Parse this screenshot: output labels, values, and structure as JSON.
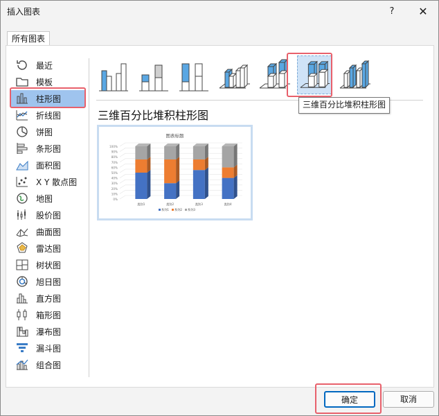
{
  "window": {
    "title": "插入图表",
    "help_icon": "?",
    "close_icon": "✕"
  },
  "tabs": [
    "所有图表"
  ],
  "sidebar": {
    "selected_index": 2,
    "items": [
      {
        "label": "最近",
        "icon": "recent-icon"
      },
      {
        "label": "模板",
        "icon": "folder-icon"
      },
      {
        "label": "柱形图",
        "icon": "column-chart-icon"
      },
      {
        "label": "折线图",
        "icon": "line-chart-icon"
      },
      {
        "label": "饼图",
        "icon": "pie-chart-icon"
      },
      {
        "label": "条形图",
        "icon": "bar-chart-icon"
      },
      {
        "label": "面积图",
        "icon": "area-chart-icon"
      },
      {
        "label": "X Y 散点图",
        "icon": "scatter-chart-icon"
      },
      {
        "label": "地图",
        "icon": "map-chart-icon"
      },
      {
        "label": "股价图",
        "icon": "stock-chart-icon"
      },
      {
        "label": "曲面图",
        "icon": "surface-chart-icon"
      },
      {
        "label": "雷达图",
        "icon": "radar-chart-icon"
      },
      {
        "label": "树状图",
        "icon": "treemap-chart-icon"
      },
      {
        "label": "旭日图",
        "icon": "sunburst-chart-icon"
      },
      {
        "label": "直方图",
        "icon": "histogram-chart-icon"
      },
      {
        "label": "箱形图",
        "icon": "boxwhisker-chart-icon"
      },
      {
        "label": "瀑布图",
        "icon": "waterfall-chart-icon"
      },
      {
        "label": "漏斗图",
        "icon": "funnel-chart-icon"
      },
      {
        "label": "组合图",
        "icon": "combo-chart-icon"
      }
    ]
  },
  "subtypes": {
    "selected_index": 5,
    "items": [
      {
        "icon": "clustered-column-icon"
      },
      {
        "icon": "stacked-column-icon"
      },
      {
        "icon": "percent-stacked-column-icon"
      },
      {
        "icon": "3d-clustered-column-icon"
      },
      {
        "icon": "3d-stacked-column-icon"
      },
      {
        "icon": "3d-percent-stacked-column-icon"
      },
      {
        "icon": "3d-column-icon"
      }
    ]
  },
  "selected_chart_name": "三维百分比堆积柱形图",
  "tooltip_text": "三维百分比堆积柱形图",
  "preview": {
    "chart_data": {
      "type": "bar",
      "title": "图表标题",
      "categories": [
        "类别1",
        "类别2",
        "类别3",
        "类别4"
      ],
      "series": [
        {
          "name": "系列1",
          "color": "#4472c4",
          "values": [
            50,
            30,
            55,
            40
          ]
        },
        {
          "name": "系列2",
          "color": "#ed7d31",
          "values": [
            25,
            45,
            20,
            20
          ]
        },
        {
          "name": "系列3",
          "color": "#a5a5a5",
          "values": [
            25,
            25,
            25,
            40
          ]
        }
      ],
      "yticks": [
        "100%",
        "90%",
        "80%",
        "70%",
        "60%",
        "50%",
        "40%",
        "30%",
        "20%",
        "10%",
        "0%"
      ],
      "ylim": [
        0,
        100
      ],
      "grid": true,
      "legend": "bottom"
    }
  },
  "buttons": {
    "ok": "确定",
    "cancel": "取消"
  },
  "colors": {
    "accent": "#0067c0",
    "highlight": "#e8606b",
    "sidebar_selected": "#9fc4ee",
    "subtype_fill": "#5aa7e3"
  }
}
